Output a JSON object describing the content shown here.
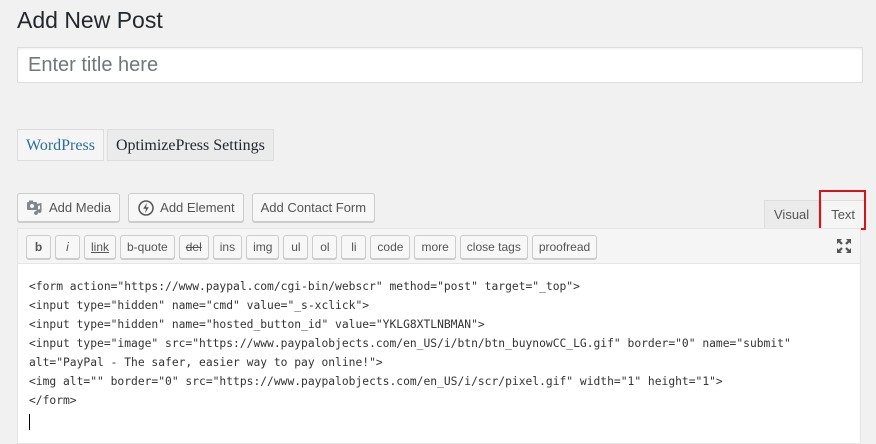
{
  "page": {
    "title": "Add New Post"
  },
  "title_field": {
    "placeholder": "Enter title here",
    "value": ""
  },
  "builder_tabs": [
    {
      "label": "WordPress",
      "active": true
    },
    {
      "label": "OptimizePress Settings",
      "active": false
    }
  ],
  "media_buttons": {
    "add_media": {
      "label": "Add Media",
      "icon": "camera-music-icon"
    },
    "add_element": {
      "label": "Add Element",
      "icon": "power-circle-icon"
    },
    "add_contact_form": {
      "label": "Add Contact Form"
    }
  },
  "editor_tabs": [
    {
      "label": "Visual",
      "active": false
    },
    {
      "label": "Text",
      "active": true,
      "highlighted": true
    }
  ],
  "quicktags": [
    "b",
    "i",
    "link",
    "b-quote",
    "del",
    "ins",
    "img",
    "ul",
    "ol",
    "li",
    "code",
    "more",
    "close tags",
    "proofread"
  ],
  "editor_content": [
    "<form action=\"https://www.paypal.com/cgi-bin/webscr\" method=\"post\" target=\"_top\">",
    "<input type=\"hidden\" name=\"cmd\" value=\"_s-xclick\">",
    "<input type=\"hidden\" name=\"hosted_button_id\" value=\"YKLG8XTLNBMAN\">",
    "<input type=\"image\" src=\"https://www.paypalobjects.com/en_US/i/btn/btn_buynowCC_LG.gif\" border=\"0\" name=\"submit\"",
    "alt=\"PayPal - The safer, easier way to pay online!\">",
    "<img alt=\"\" border=\"0\" src=\"https://www.paypalobjects.com/en_US/i/scr/pixel.gif\" width=\"1\" height=\"1\">",
    "</form>"
  ],
  "colors": {
    "highlight": "#d9131b",
    "active_tab_text": "#2a6f97",
    "background": "#f1f1f1"
  }
}
